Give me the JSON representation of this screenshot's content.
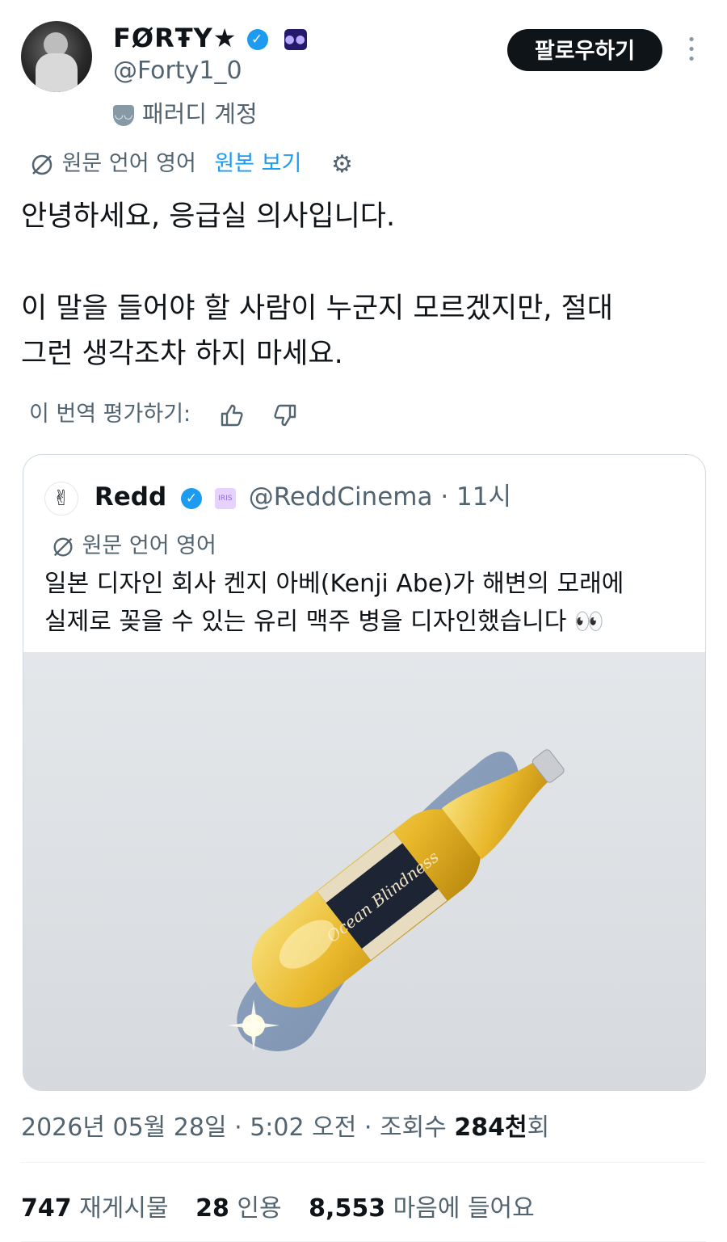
{
  "author": {
    "display_name": "FØRŦY★",
    "handle": "@Forty1_0",
    "parody_label": "패러디 계정",
    "verified": true
  },
  "follow_button": "팔로우하기",
  "translation_bar": {
    "source_language": "원문 언어 영어",
    "show_original": "원본 보기"
  },
  "tweet": {
    "line1": "안녕하세요, 응급실 의사입니다.",
    "line2": "이 말을 들어야 할 사람이 누군지 모르겠지만, 절대",
    "line3": "그런 생각조차 하지 마세요."
  },
  "rate_translation": "이 번역 평가하기:",
  "quoted": {
    "name": "Redd",
    "handle": "@ReddCinema",
    "dot": "·",
    "time": "11시",
    "affiliate_badge": "IRIS",
    "source_language": "원문 언어 영어",
    "line1": "일본 디자인 회사 켄지 아베(Kenji Abe)가 해변의 모래에",
    "line2": "실제로 꽂을 수 있는 유리 맥주 병을 디자인했습니다 👀",
    "label_text": "Ocean Blindness"
  },
  "timestamp": {
    "date": "2026년 05월 28일",
    "sep1": "·",
    "time": "5:02 오전",
    "sep2": "·",
    "views_label": "조회수",
    "views_value": "284천",
    "views_suffix": "회"
  },
  "stats": {
    "reposts_value": "747",
    "reposts_label": "재게시물",
    "quotes_value": "28",
    "quotes_label": "인용",
    "likes_value": "8,553",
    "likes_label": "마음에 들어요"
  },
  "colors": {
    "accent": "#1d9bf0",
    "text": "#0f1419",
    "secondary": "#536471"
  }
}
